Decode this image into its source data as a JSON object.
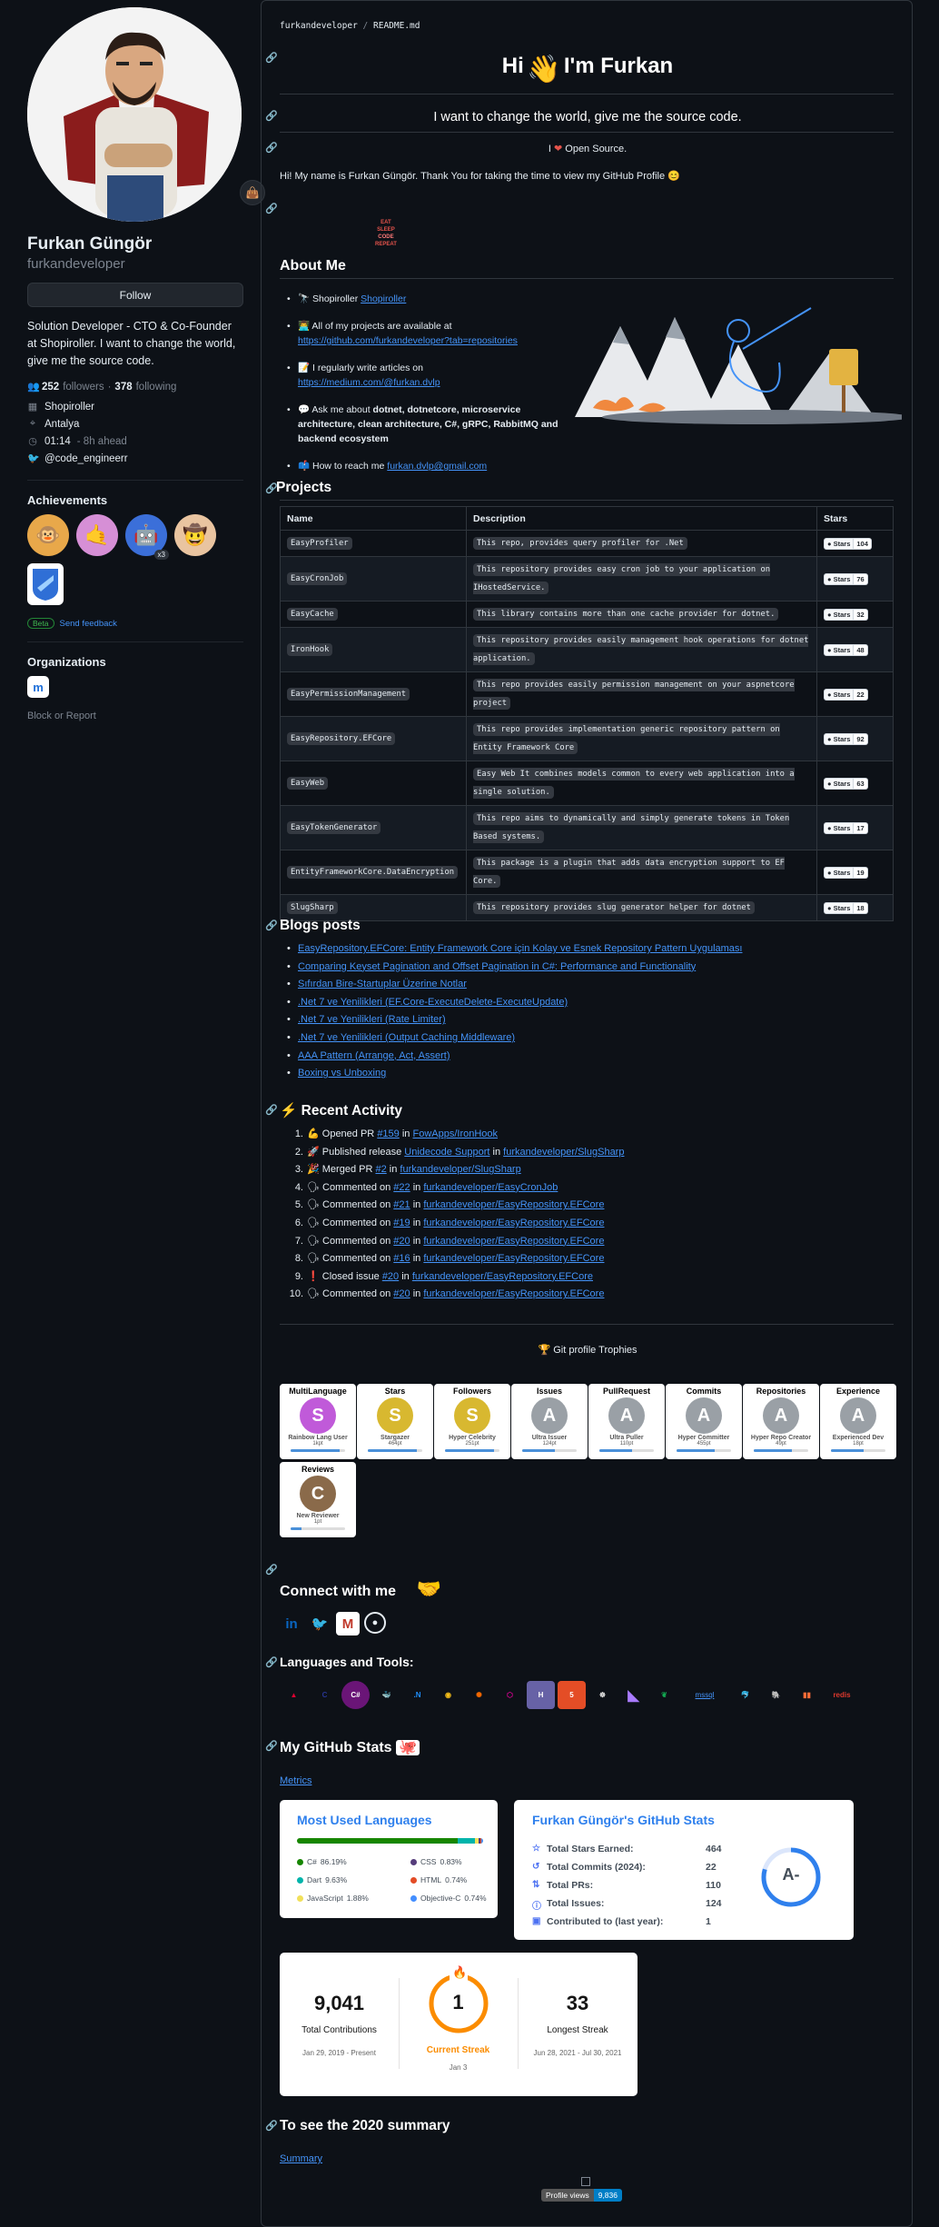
{
  "profile": {
    "name": "Furkan Güngör",
    "login": "furkandeveloper",
    "follow_label": "Follow",
    "bio": "Solution Developer - CTO & Co-Founder at Shopiroller. I want to change the world, give me the source code.",
    "followers_count": "252",
    "followers_label": "followers",
    "following_count": "378",
    "following_label": "following",
    "company": "Shopiroller",
    "location": "Antalya",
    "time": "01:14",
    "time_note": "- 8h ahead",
    "twitter": "@code_engineerr",
    "achievements_title": "Achievements",
    "achievement_multiplier": "x3",
    "beta_label": "Beta",
    "feedback_label": "Send feedback",
    "organizations_title": "Organizations",
    "block_label": "Block or Report"
  },
  "readme": {
    "path_user": "furkandeveloper",
    "path_sep": "/",
    "path_file": "README.md",
    "greeting_a": "Hi",
    "greeting_b": "I'm Furkan",
    "tagline": "I want to change the world, give me the source code.",
    "opensource_a": "I",
    "opensource_b": "Open Source.",
    "intro": "Hi! My name is Furkan Güngör. Thank You for taking the time to view my GitHub Profile",
    "eat_lines": [
      "EAT",
      "SLEEP",
      "CODE",
      "REPEAT"
    ],
    "about_title": "About Me",
    "about": {
      "item1_text": "Shopiroller",
      "item1_link": "Shopiroller",
      "item2_text": "All of my projects are available at",
      "item2_link": "https://github.com/furkandeveloper?tab=repositories",
      "item3_text": "I regularly write articles on",
      "item3_link": "https://medium.com/@furkan.dvlp",
      "item4_a": "Ask me about",
      "item4_b": "dotnet, dotnetcore, microservice architecture, clean architecture, C#, gRPC, RabbitMQ and backend ecosystem",
      "item5_text": "How to reach me",
      "item5_link": "furkan.dvlp@gmail.com"
    },
    "projects_title": "Projects",
    "projects_headers": [
      "Name",
      "Description",
      "Stars"
    ],
    "stars_label": "Stars",
    "projects": [
      {
        "name": "EasyProfiler",
        "desc": "This repo, provides query profiler for .Net",
        "stars": "104"
      },
      {
        "name": "EasyCronJob",
        "desc": "This repository provides easy cron job to your application on IHostedService.",
        "stars": "76"
      },
      {
        "name": "EasyCache",
        "desc": " This library contains more than one cache provider for dotnet.",
        "stars": "32"
      },
      {
        "name": "IronHook",
        "desc": "This repository provides easily management hook operations for dotnet application.",
        "stars": "48"
      },
      {
        "name": "EasyPermissionManagement",
        "desc": "This repo provides easily permission management on your aspnetcore project",
        "stars": "22"
      },
      {
        "name": "EasyRepository.EFCore",
        "desc": "This repo provides implementation generic repository pattern on Entity Framework Core",
        "stars": "92"
      },
      {
        "name": "EasyWeb",
        "desc": "Easy Web It combines models common to every web application into a single solution.",
        "stars": "63"
      },
      {
        "name": "EasyTokenGenerator",
        "desc": "This repo aims to dynamically and simply generate tokens in Token Based systems.",
        "stars": "17"
      },
      {
        "name": "EntityFrameworkCore.DataEncryption",
        "desc": "This package is a plugin that adds data encryption support to EF Core.",
        "stars": "19"
      },
      {
        "name": "SlugSharp",
        "desc": "This repository provides slug generator helper for dotnet",
        "stars": "18"
      }
    ],
    "blogs_title": "Blogs posts",
    "blogs": [
      "EasyRepository.EFCore: Entity Framework Core için Kolay ve Esnek Repository Pattern Uygulaması",
      "Comparing Keyset Pagination and Offset Pagination in C#: Performance and Functionality",
      "Sıfırdan Bire-Startuplar Üzerine Notlar",
      ".Net 7 ve Yenilikleri (EF.Core-ExecuteDelete-ExecuteUpdate)",
      ".Net 7 ve Yenilikleri (Rate Limiter)",
      ".Net 7 ve Yenilikleri (Output Caching Middleware)",
      "AAA Pattern (Arrange, Act, Assert)",
      "Boxing vs Unboxing"
    ],
    "activity_title": "Recent Activity",
    "activity": [
      {
        "n": "1.",
        "icon": "💪",
        "a": "Opened PR ",
        "l1": "#159",
        "b": " in ",
        "l2": "FowApps/IronHook"
      },
      {
        "n": "2.",
        "icon": "🚀",
        "a": "Published release ",
        "l1": "Unidecode Support",
        "b": " in ",
        "l2": "furkandeveloper/SlugSharp"
      },
      {
        "n": "3.",
        "icon": "🎉",
        "a": "Merged PR ",
        "l1": "#2",
        "b": " in ",
        "l2": "furkandeveloper/SlugSharp"
      },
      {
        "n": "4.",
        "icon": "🗣",
        "a": "Commented on ",
        "l1": "#22",
        "b": " in ",
        "l2": "furkandeveloper/EasyCronJob"
      },
      {
        "n": "5.",
        "icon": "🗣",
        "a": "Commented on ",
        "l1": "#21",
        "b": " in ",
        "l2": "furkandeveloper/EasyRepository.EFCore"
      },
      {
        "n": "6.",
        "icon": "🗣",
        "a": "Commented on ",
        "l1": "#19",
        "b": " in ",
        "l2": "furkandeveloper/EasyRepository.EFCore"
      },
      {
        "n": "7.",
        "icon": "🗣",
        "a": "Commented on ",
        "l1": "#20",
        "b": " in ",
        "l2": "furkandeveloper/EasyRepository.EFCore"
      },
      {
        "n": "8.",
        "icon": "🗣",
        "a": "Commented on ",
        "l1": "#16",
        "b": " in ",
        "l2": "furkandeveloper/EasyRepository.EFCore"
      },
      {
        "n": "9.",
        "icon": "❗",
        "a": "Closed issue ",
        "l1": "#20",
        "b": " in ",
        "l2": "furkandeveloper/EasyRepository.EFCore"
      },
      {
        "n": "10.",
        "icon": "🗣",
        "a": "Commented on ",
        "l1": "#20",
        "b": " in ",
        "l2": "furkandeveloper/EasyRepository.EFCore"
      }
    ],
    "trophies_title": "Git profile Trophies",
    "trophies": [
      {
        "title": "MultiLanguage",
        "rank": "S",
        "name": "Rainbow Lang User",
        "pt": "1kpt",
        "color": "#c05ad9",
        "fill": 0.9
      },
      {
        "title": "Stars",
        "rank": "S",
        "name": "Stargazer",
        "pt": "464pt",
        "color": "#d8b830",
        "fill": 0.9
      },
      {
        "title": "Followers",
        "rank": "S",
        "name": "Hyper Celebrity",
        "pt": "251pt",
        "color": "#d8b830",
        "fill": 0.9
      },
      {
        "title": "Issues",
        "rank": "A",
        "name": "Ultra Issuer",
        "pt": "124pt",
        "color": "#9aa0a6",
        "fill": 0.6
      },
      {
        "title": "PullRequest",
        "rank": "A",
        "name": "Ultra Puller",
        "pt": "110pt",
        "color": "#9aa0a6",
        "fill": 0.6
      },
      {
        "title": "Commits",
        "rank": "A",
        "name": "Hyper Committer",
        "pt": "455pt",
        "color": "#9aa0a6",
        "fill": 0.7
      },
      {
        "title": "Repositories",
        "rank": "A",
        "name": "Hyper Repo Creator",
        "pt": "49pt",
        "color": "#9aa0a6",
        "fill": 0.7
      },
      {
        "title": "Experience",
        "rank": "A",
        "name": "Experienced Dev",
        "pt": "18pt",
        "color": "#9aa0a6",
        "fill": 0.6
      },
      {
        "title": "Reviews",
        "rank": "C",
        "name": "New Reviewer",
        "pt": "1pt",
        "color": "#8a6a4a",
        "fill": 0.2
      }
    ],
    "connect_title": "Connect with me",
    "languages_title": "Languages and Tools:",
    "tools": [
      "angular",
      "C",
      "csharp",
      "docker",
      "dotnet",
      "elastic",
      "grafana",
      "graphql",
      "heroku",
      "html5",
      "k8s",
      "kotlin",
      "mongodb",
      "mssql",
      "mysql",
      "postgres",
      "postman",
      "rabbitmq",
      "redis"
    ],
    "tools_visible_mssql": "mssql",
    "stats_title": "My GitHub Stats",
    "metrics_alt": "Metrics",
    "most_used_title": "Most Used Languages",
    "languages": [
      {
        "name": "C#",
        "pct": "86.19%",
        "color": "#178600",
        "v": 86.19
      },
      {
        "name": "CSS",
        "pct": "0.83%",
        "color": "#563d7c",
        "v": 0.83
      },
      {
        "name": "Dart",
        "pct": "9.63%",
        "color": "#00B4AB",
        "v": 9.63
      },
      {
        "name": "HTML",
        "pct": "0.74%",
        "color": "#e34c26",
        "v": 0.74
      },
      {
        "name": "JavaScript",
        "pct": "1.88%",
        "color": "#f1e05a",
        "v": 1.88
      },
      {
        "name": "Objective-C",
        "pct": "0.74%",
        "color": "#438eff",
        "v": 0.74
      }
    ],
    "gh_stats_title": "Furkan Güngör's GitHub Stats",
    "gh_stats": [
      {
        "k": "Total Stars Earned:",
        "v": "464",
        "icon": "☆"
      },
      {
        "k": "Total Commits (2024):",
        "v": "22",
        "icon": "↺"
      },
      {
        "k": "Total PRs:",
        "v": "110",
        "icon": "⇅"
      },
      {
        "k": "Total Issues:",
        "v": "124",
        "icon": "ⓘ"
      },
      {
        "k": "Contributed to (last year):",
        "v": "1",
        "icon": "▣"
      }
    ],
    "grade": "A-",
    "streak": {
      "total": "9,041",
      "total_label": "Total Contributions",
      "total_range": "Jan 29, 2019 - Present",
      "current": "1",
      "current_label": "Current Streak",
      "current_range": "Jan 3",
      "longest": "33",
      "longest_label": "Longest Streak",
      "longest_range": "Jun 28, 2021 - Jul 30, 2021"
    },
    "summary_title": "To see the 2020 summary",
    "summary_link": "Summary",
    "profile_views_label": "Profile views",
    "profile_views_value": "9,836"
  },
  "colors": {
    "bg": "#0d1117",
    "link": "#4493f8",
    "border": "#30363d",
    "muted": "#7d8590"
  }
}
